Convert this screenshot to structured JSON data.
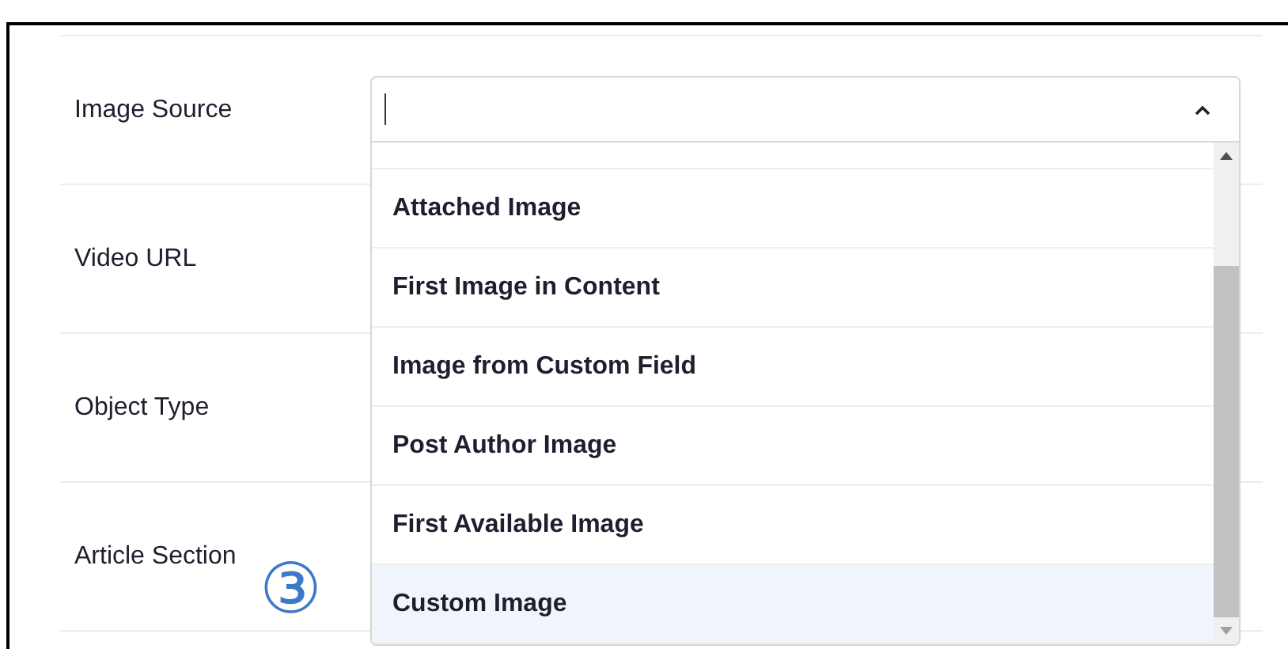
{
  "fields": [
    {
      "label": "Image Source"
    },
    {
      "label": "Video URL"
    },
    {
      "label": "Object Type"
    },
    {
      "label": "Article Section"
    }
  ],
  "dropdown": {
    "expanded": true,
    "options": [
      {
        "label": "Attached Image",
        "selected": false
      },
      {
        "label": "First Image in Content",
        "selected": false
      },
      {
        "label": "Image from Custom Field",
        "selected": false
      },
      {
        "label": "Post Author Image",
        "selected": false
      },
      {
        "label": "First Available Image",
        "selected": false
      },
      {
        "label": "Custom Image",
        "selected": true
      }
    ]
  },
  "annotation": {
    "marker": "③"
  }
}
